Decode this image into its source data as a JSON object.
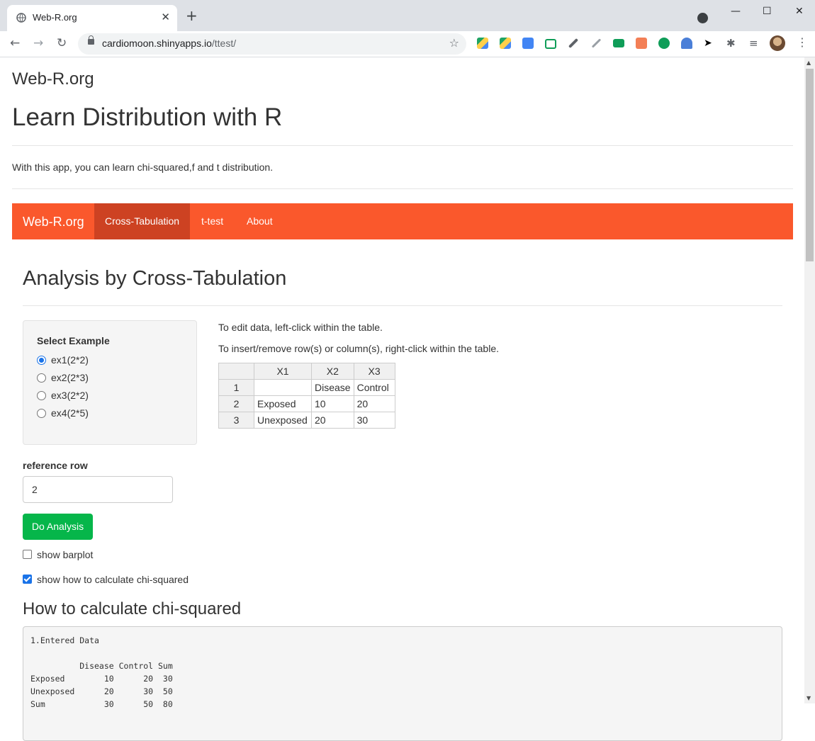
{
  "browser": {
    "tab_title": "Web-R.org",
    "url_host": "cardiomoon.shinyapps.io",
    "url_path": "/ttest/"
  },
  "page": {
    "site_name": "Web-R.org",
    "main_title": "Learn Distribution with R",
    "description": "With this app, you can learn chi-squared,f and t distribution."
  },
  "navbar": {
    "brand": "Web-R.org",
    "items": [
      {
        "label": "Cross-Tabulation",
        "active": true
      },
      {
        "label": "t-test",
        "active": false
      },
      {
        "label": "About",
        "active": false
      }
    ],
    "color": "#fa582c",
    "active_color": "#cd4222"
  },
  "section": {
    "title": "Analysis by Cross-Tabulation"
  },
  "example": {
    "label": "Select Example",
    "options": [
      "ex1(2*2)",
      "ex2(2*3)",
      "ex3(2*2)",
      "ex4(2*5)"
    ],
    "selected": "ex1(2*2)"
  },
  "instructions": {
    "line1": "To edit data, left-click within the table.",
    "line2": "To insert/remove row(s) or column(s), right-click within the table."
  },
  "table": {
    "columns": [
      "X1",
      "X2",
      "X3"
    ],
    "rows": [
      {
        "index": "1",
        "cells": [
          "",
          "Disease",
          "Control"
        ]
      },
      {
        "index": "2",
        "cells": [
          "Exposed",
          "10",
          "20"
        ]
      },
      {
        "index": "3",
        "cells": [
          "Unexposed",
          "20",
          "30"
        ]
      }
    ]
  },
  "reference_row": {
    "label": "reference row",
    "value": "2"
  },
  "analysis_button": "Do Analysis",
  "checkboxes": {
    "barplot": {
      "label": "show barplot",
      "checked": false
    },
    "chisq": {
      "label": "show how to calculate chi-squared",
      "checked": true
    }
  },
  "how": {
    "title": "How to calculate chi-squared",
    "output": "1.Entered Data\n\n          Disease Control Sum\nExposed        10      20  30\nUnexposed      20      30  50\nSum            30      50  80"
  },
  "colors": {
    "button_green": "#06b64a"
  }
}
